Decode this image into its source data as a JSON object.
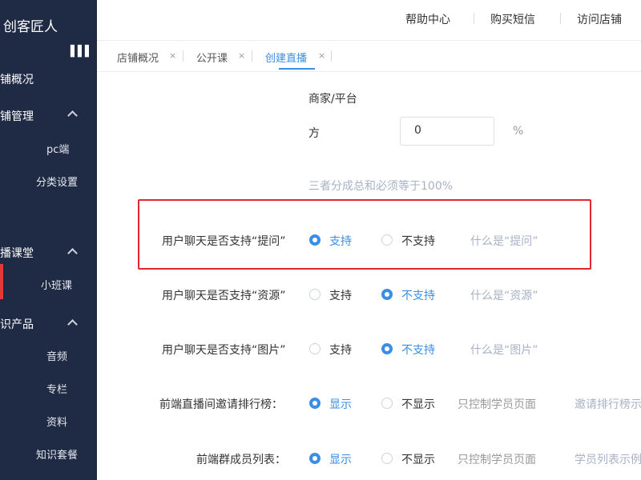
{
  "app": {
    "title": "创客匠人"
  },
  "sidebar": {
    "collapse_icon": "collapse-icon",
    "items": [
      {
        "label": "铺概况"
      },
      {
        "label": "铺管理"
      },
      {
        "label": "pc端"
      },
      {
        "label": "分类设置"
      },
      {
        "label": "播课堂"
      },
      {
        "label": "小班课"
      },
      {
        "label": "识产品"
      },
      {
        "label": "音频"
      },
      {
        "label": "专栏"
      },
      {
        "label": "资料"
      },
      {
        "label": "知识套餐"
      }
    ]
  },
  "header": {
    "links": [
      "帮助中心",
      "购买短信",
      "访问店铺"
    ]
  },
  "tabs": [
    {
      "label": "店铺概况",
      "close": "×"
    },
    {
      "label": "公开课",
      "close": "×"
    },
    {
      "label": "创建直播",
      "close": "×"
    }
  ],
  "form": {
    "platform_label_line1": "商家/平台",
    "platform_label_line2": "方",
    "platform_value": "0",
    "platform_unit": "%",
    "split_hint": "三者分成总和必须等于100%",
    "rows": [
      {
        "label": "用户聊天是否支持“提问”",
        "opt1": "支持",
        "opt2": "不支持",
        "selected": 1,
        "extra": "",
        "hint": "什么是“提问”"
      },
      {
        "label": "用户聊天是否支持“资源”",
        "opt1": "支持",
        "opt2": "不支持",
        "selected": 2,
        "extra": "",
        "hint": "什么是“资源”"
      },
      {
        "label": "用户聊天是否支持“图片”",
        "opt1": "支持",
        "opt2": "不支持",
        "selected": 2,
        "extra": "",
        "hint": "什么是“图片”"
      },
      {
        "label": "前端直播间邀请排行榜：",
        "opt1": "显示",
        "opt2": "不显示",
        "selected": 1,
        "extra": "只控制学员页面",
        "hint": "邀请排行榜示"
      },
      {
        "label": "前端群成员列表：",
        "opt1": "显示",
        "opt2": "不显示",
        "selected": 1,
        "extra": "只控制学员页面",
        "hint": "学员列表示例"
      }
    ]
  }
}
